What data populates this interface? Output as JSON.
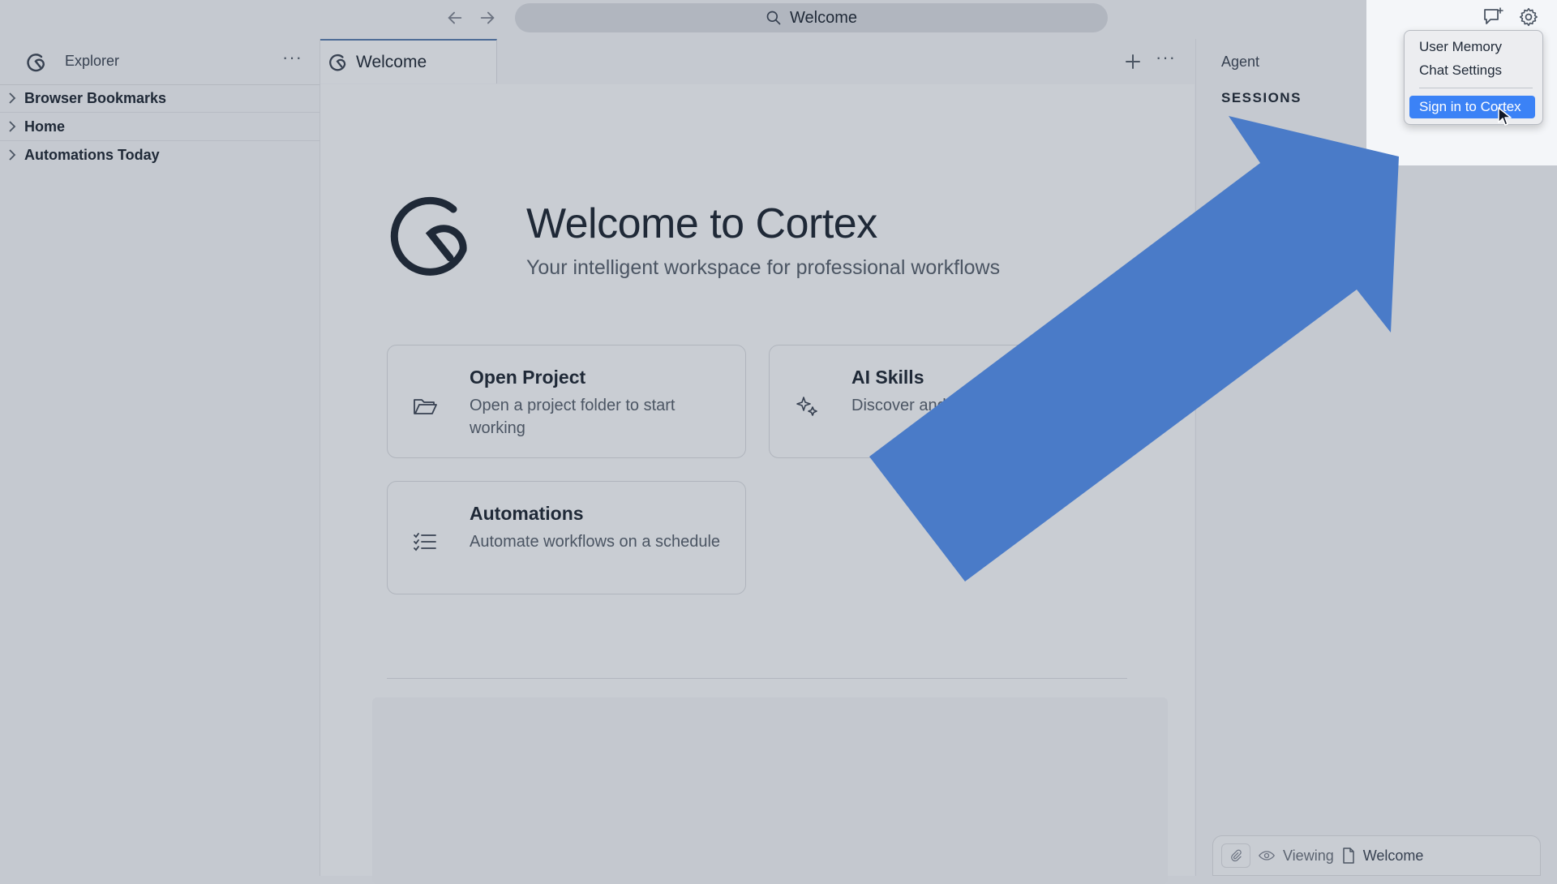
{
  "toolbar": {
    "search_text": "Welcome"
  },
  "sidebar": {
    "title": "Explorer",
    "items": [
      {
        "label": "Browser Bookmarks"
      },
      {
        "label": "Home"
      },
      {
        "label": "Automations Today"
      }
    ]
  },
  "editor": {
    "tab_label": "Welcome",
    "hero_title": "Welcome to Cortex",
    "hero_subtitle": "Your intelligent workspace for professional workflows",
    "cards": [
      {
        "title": "Open Project",
        "desc": "Open a project folder to start working",
        "icon": "folder-open-icon"
      },
      {
        "title": "AI Skills",
        "desc": "Discover and use AI-powered skills",
        "icon": "sparkle-icon"
      },
      {
        "title": "Automations",
        "desc": "Automate workflows on a schedule",
        "icon": "list-check-icon"
      }
    ]
  },
  "agent": {
    "title": "Agent",
    "sessions_label": "SESSIONS"
  },
  "settings_menu": {
    "items": [
      {
        "label": "User Memory"
      },
      {
        "label": "Chat Settings"
      }
    ],
    "highlighted": "Sign in to Cortex"
  },
  "status": {
    "viewing_label": "Viewing",
    "document": "Welcome"
  },
  "colors": {
    "accent": "#3b82f6",
    "arrow": "#4a7bc8",
    "tab_indicator": "#4d6b96"
  }
}
